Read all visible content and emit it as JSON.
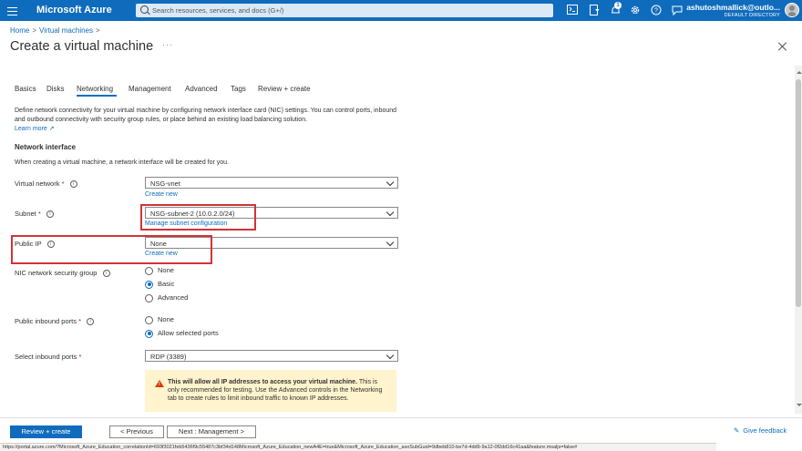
{
  "topbar": {
    "brand": "Microsoft Azure",
    "search_placeholder": "Search resources, services, and docs (G+/)",
    "notification_count": "1",
    "user_email": "ashutoshmallick@outlo...",
    "user_directory": "DEFAULT DIRECTORY",
    "accent": "#0f6cbd"
  },
  "breadcrumb": {
    "home": "Home",
    "sep": ">",
    "vms": "Virtual machines",
    "sep2": ">"
  },
  "page": {
    "title": "Create a virtual machine",
    "more": "···"
  },
  "tabs": [
    "Basics",
    "Disks",
    "Networking",
    "Management",
    "Advanced",
    "Tags",
    "Review + create"
  ],
  "active_tab": "Networking",
  "intro": {
    "text": "Define network connectivity for your virtual machine by configuring network interface card (NIC) settings. You can control ports, inbound and outbound connectivity with security group rules, or place behind an existing load balancing solution.",
    "learn_more": "Learn more ↗"
  },
  "section": {
    "heading": "Network interface",
    "note": "When creating a virtual machine, a network interface will be created for you."
  },
  "fields": {
    "virtual_network": {
      "label": "Virtual network",
      "req": "*",
      "value": "NSG-vnet",
      "link": "Create new"
    },
    "subnet": {
      "label": "Subnet",
      "req": "*",
      "value": "NSG-subnet-2 (10.0.2.0/24)",
      "link": "Manage subnet configuration"
    },
    "public_ip": {
      "label": "Public IP",
      "value": "None",
      "link": "Create new"
    },
    "nic_nsg": {
      "label": "NIC network security group",
      "options": [
        "None",
        "Basic",
        "Advanced"
      ],
      "selected": "Basic"
    },
    "public_inbound_ports": {
      "label": "Public inbound ports",
      "req": "*",
      "options": [
        "None",
        "Allow selected ports"
      ],
      "selected": "Allow selected ports"
    },
    "select_inbound_ports": {
      "label": "Select inbound ports",
      "req": "*",
      "value": "RDP (3389)"
    }
  },
  "warning": {
    "bold": "This will allow all IP addresses to access your virtual machine.",
    "text": "This is only recommended for testing.  Use the Advanced controls in the Networking tab to create rules to limit inbound traffic to known IP addresses."
  },
  "footer": {
    "review_create": "Review + create",
    "previous": "< Previous",
    "next": "Next : Management >",
    "feedback": "Give feedback"
  },
  "status_url": "https://portal.azure.com/?Microsoft_Azure_Education_correlationId=693f3021feb5436f9c55487c3bf34d148Microsoft_Azure_Education_newA4E=true&Microsoft_Azure_Education_asoSubGuid=9dbeb810-be7d-4dd9-9a12-0f2dd16c41aa&feature.msaljs=false#"
}
